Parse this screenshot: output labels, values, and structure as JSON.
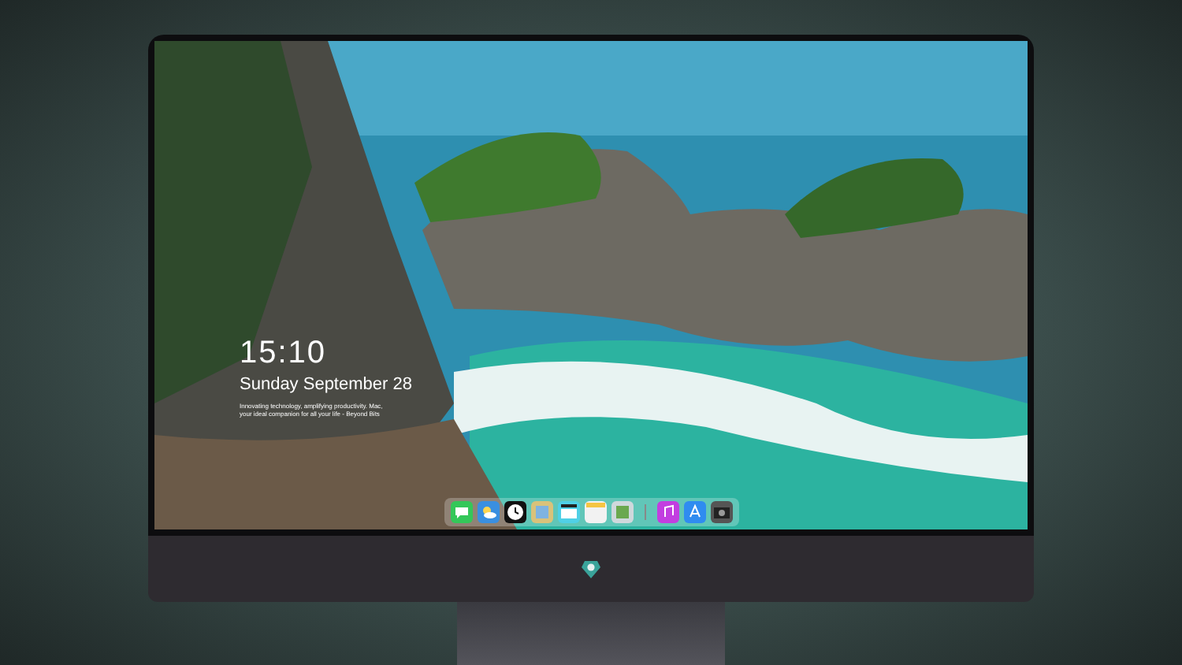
{
  "lock_screen": {
    "time": "15:10",
    "date": "Sunday September 28",
    "caption": [
      "Innovating technology, amplifying productivity. Mac,",
      "your ideal companion for all your life - Beyond Bits"
    ]
  },
  "dock": {
    "apps": [
      {
        "kind": "messages",
        "color": "#34c759"
      },
      {
        "kind": "weather",
        "color": "#3a8fe0"
      },
      {
        "kind": "clock",
        "color": "#111111"
      },
      {
        "kind": "preview",
        "color": "#d9c27a"
      },
      {
        "kind": "clips",
        "color": "#4fd0e6"
      },
      {
        "kind": "notes",
        "color": "#f2f2f2"
      },
      {
        "kind": "photos",
        "color": "#cfd8dc"
      },
      {
        "kind": "separator",
        "color": "#888888"
      },
      {
        "kind": "music",
        "color": "#c23ee0"
      },
      {
        "kind": "store",
        "color": "#2f8cf0"
      },
      {
        "kind": "camera",
        "color": "#555555"
      }
    ]
  }
}
